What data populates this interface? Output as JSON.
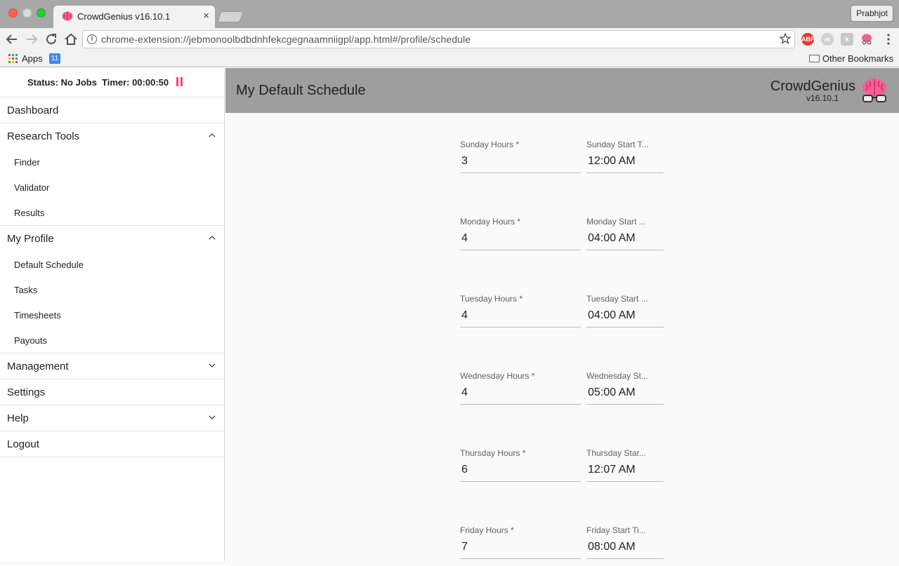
{
  "browser": {
    "tab_title": "CrowdGenius v16.10.1",
    "tab_close": "×",
    "profile_name": "Prabhjot",
    "url": "chrome-extension://jebmonoolbdbdnhfekcgegnaamniigpl/app.html#/profile/schedule",
    "bookmarks": {
      "apps_label": "Apps",
      "calendar_day": "11",
      "other": "Other Bookmarks"
    },
    "extensions": [
      "abp-icon",
      "m-icon",
      "k-icon",
      "brain-icon"
    ]
  },
  "sidebar": {
    "status": "Status: No Jobs",
    "timer": "Timer: 00:00:50",
    "nav": {
      "dashboard": "Dashboard",
      "research_tools": "Research Tools",
      "research_items": [
        "Finder",
        "Validator",
        "Results"
      ],
      "my_profile": "My Profile",
      "profile_items": [
        "Default Schedule",
        "Tasks",
        "Timesheets",
        "Payouts"
      ],
      "management": "Management",
      "settings": "Settings",
      "help": "Help",
      "logout": "Logout"
    }
  },
  "header": {
    "title": "My Default Schedule",
    "brand": "CrowdGenius",
    "version": "v16.10.1"
  },
  "schedule": [
    {
      "hours_label": "Sunday Hours *",
      "hours": "3",
      "start_label": "Sunday Start T...",
      "start": "12:00  AM"
    },
    {
      "hours_label": "Monday Hours *",
      "hours": "4",
      "start_label": "Monday Start ...",
      "start": "04:00  AM"
    },
    {
      "hours_label": "Tuesday Hours *",
      "hours": "4",
      "start_label": "Tuesday Start ...",
      "start": "04:00  AM"
    },
    {
      "hours_label": "Wednesday Hours *",
      "hours": "4",
      "start_label": "Wednesday St...",
      "start": "05:00  AM"
    },
    {
      "hours_label": "Thursday Hours *",
      "hours": "6",
      "start_label": "Thursday Star...",
      "start": "12:07  AM"
    },
    {
      "hours_label": "Friday Hours *",
      "hours": "7",
      "start_label": "Friday Start Ti...",
      "start": "08:00  AM"
    }
  ]
}
